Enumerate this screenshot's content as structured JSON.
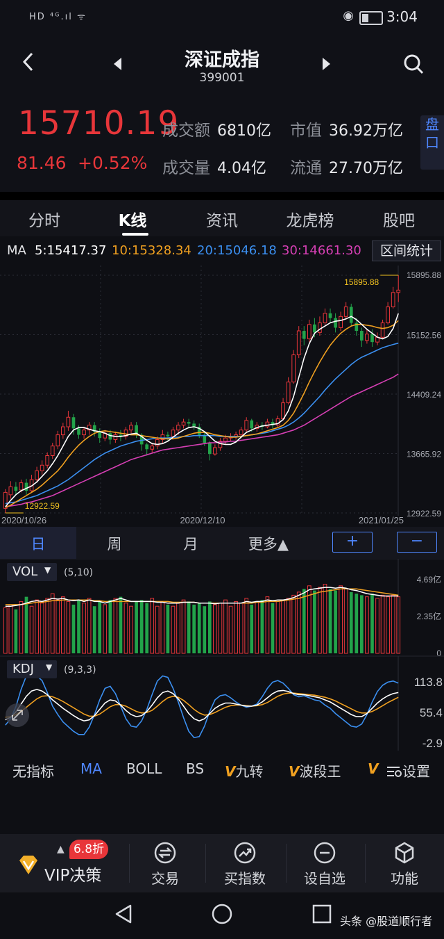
{
  "status_bar": {
    "left_icons": "HD ⁴ᴳ.ıl ᯤ",
    "time": "3:04"
  },
  "header": {
    "title": "深证成指",
    "code": "399001"
  },
  "quote": {
    "price": "15710.19",
    "change": "81.46",
    "change_pct": "+0.52%",
    "turnover_label": "成交额",
    "turnover_value": "6810亿",
    "volume_label": "成交量",
    "volume_value": "4.04亿",
    "mktcap_label": "市值",
    "mktcap_value": "36.92万亿",
    "float_label": "流通",
    "float_value": "27.70万亿",
    "pankou": "盘口",
    "up_color": "#e8363a",
    "down_color": "#22a34a"
  },
  "tabs": [
    "分时",
    "K线",
    "资讯",
    "龙虎榜",
    "股吧"
  ],
  "active_tab": "K线",
  "ma_line": {
    "prefix": "MA",
    "ma5": "5:15417.37",
    "ma10": "10:15328.34",
    "ma20": "20:15046.18",
    "ma30": "30:14661.30",
    "range_button": "区间统计",
    "colors": {
      "ma5": "#ffffff",
      "ma10": "#f0a020",
      "ma20": "#3b8ff0",
      "ma30": "#d63fb4"
    }
  },
  "chart_data": {
    "type": "candlestick",
    "y_ticks": [
      "15895.88",
      "15152.56",
      "14409.24",
      "13665.92",
      "12922.59"
    ],
    "x_ticks": [
      "2020/10/26",
      "2020/12/10",
      "2021/01/25"
    ],
    "max_label": "15895.88",
    "min_label": "12922.59",
    "ylim": [
      12922.59,
      15895.88
    ],
    "candles": [
      [
        12980,
        13180,
        12922.59,
        13220
      ],
      [
        13150,
        13250,
        13100,
        13320
      ],
      [
        13250,
        13200,
        13150,
        13310
      ],
      [
        13210,
        13300,
        13180,
        13340
      ],
      [
        13300,
        13200,
        13150,
        13350
      ],
      [
        13200,
        13340,
        13180,
        13400
      ],
      [
        13340,
        13450,
        13300,
        13500
      ],
      [
        13450,
        13520,
        13400,
        13580
      ],
      [
        13520,
        13640,
        13480,
        13680
      ],
      [
        13640,
        13760,
        13600,
        13800
      ],
      [
        13760,
        13900,
        13720,
        13950
      ],
      [
        13900,
        14000,
        13850,
        14050
      ],
      [
        14000,
        14120,
        13950,
        14200
      ],
      [
        14120,
        13980,
        13900,
        14160
      ],
      [
        13980,
        13900,
        13850,
        14020
      ],
      [
        13900,
        13960,
        13850,
        14000
      ],
      [
        13960,
        14020,
        13900,
        14060
      ],
      [
        14020,
        13940,
        13880,
        14060
      ],
      [
        13940,
        13860,
        13800,
        13980
      ],
      [
        13860,
        13920,
        13820,
        13960
      ],
      [
        13920,
        13840,
        13780,
        13960
      ],
      [
        13840,
        13900,
        13800,
        13940
      ],
      [
        13900,
        13880,
        13820,
        13960
      ],
      [
        13880,
        13960,
        13840,
        14000
      ],
      [
        13960,
        14020,
        13920,
        14060
      ],
      [
        14020,
        13900,
        13860,
        14060
      ],
      [
        13900,
        13780,
        13700,
        13920
      ],
      [
        13780,
        13720,
        13640,
        13800
      ],
      [
        13720,
        13760,
        13680,
        13800
      ],
      [
        13760,
        13840,
        13720,
        13880
      ],
      [
        13840,
        13900,
        13800,
        13960
      ],
      [
        13900,
        13880,
        13820,
        13940
      ],
      [
        13880,
        13960,
        13840,
        14000
      ],
      [
        13960,
        14020,
        13900,
        14060
      ],
      [
        14020,
        14060,
        13980,
        14100
      ],
      [
        14060,
        14040,
        13980,
        14100
      ],
      [
        14040,
        14000,
        13960,
        14080
      ],
      [
        14000,
        13900,
        13860,
        14040
      ],
      [
        13900,
        13800,
        13760,
        13940
      ],
      [
        13800,
        13660,
        13580,
        13820
      ],
      [
        13660,
        13740,
        13640,
        13780
      ],
      [
        13740,
        13820,
        13700,
        13860
      ],
      [
        13820,
        13860,
        13780,
        13900
      ],
      [
        13860,
        13880,
        13820,
        13920
      ],
      [
        13880,
        13900,
        13840,
        13940
      ],
      [
        13900,
        13960,
        13860,
        14000
      ],
      [
        13960,
        14080,
        13940,
        14120
      ],
      [
        14080,
        13980,
        13940,
        14100
      ],
      [
        13980,
        14020,
        13940,
        14060
      ],
      [
        14020,
        14000,
        13960,
        14060
      ],
      [
        14000,
        14060,
        13980,
        14100
      ],
      [
        14060,
        14020,
        13980,
        14100
      ],
      [
        14020,
        14100,
        14000,
        14140
      ],
      [
        14100,
        14300,
        14080,
        14360
      ],
      [
        14300,
        14560,
        14280,
        14620
      ],
      [
        14560,
        14900,
        14540,
        14960
      ],
      [
        14900,
        15200,
        14860,
        15260
      ],
      [
        15200,
        15100,
        15020,
        15260
      ],
      [
        15100,
        15280,
        15060,
        15340
      ],
      [
        15280,
        15180,
        15120,
        15360
      ],
      [
        15180,
        15300,
        15140,
        15380
      ],
      [
        15300,
        15420,
        15260,
        15480
      ],
      [
        15420,
        15360,
        15300,
        15480
      ],
      [
        15360,
        15240,
        15180,
        15420
      ],
      [
        15240,
        15380,
        15200,
        15440
      ],
      [
        15380,
        15500,
        15340,
        15560
      ],
      [
        15500,
        15300,
        15260,
        15540
      ],
      [
        15300,
        15200,
        15140,
        15360
      ],
      [
        15200,
        15080,
        15000,
        15240
      ],
      [
        15080,
        15160,
        15040,
        15220
      ],
      [
        15160,
        15060,
        15000,
        15220
      ],
      [
        15060,
        15120,
        15020,
        15180
      ],
      [
        15120,
        15300,
        15100,
        15340
      ],
      [
        15300,
        15500,
        15280,
        15560
      ],
      [
        15500,
        15680,
        15480,
        15750
      ],
      [
        15680,
        15710.19,
        15560,
        15895.88
      ]
    ],
    "ma5": [
      13000,
      13080,
      13150,
      13200,
      13230,
      13260,
      13310,
      13380,
      13450,
      13540,
      13640,
      13760,
      13880,
      13960,
      13990,
      13990,
      13970,
      13950,
      13940,
      13920,
      13890,
      13880,
      13880,
      13890,
      13910,
      13920,
      13880,
      13830,
      13790,
      13780,
      13790,
      13820,
      13870,
      13920,
      13960,
      13990,
      14000,
      13980,
      13940,
      13880,
      13820,
      13790,
      13780,
      13780,
      13810,
      13870,
      13930,
      13960,
      13990,
      14010,
      14020,
      14030,
      14040,
      14090,
      14200,
      14380,
      14620,
      14860,
      15040,
      15170,
      15220,
      15260,
      15300,
      15320,
      15330,
      15350,
      15380,
      15340,
      15280,
      15220,
      15170,
      15120,
      15100,
      15130,
      15230,
      15417.37
    ],
    "ma10": [
      12990,
      13020,
      13060,
      13100,
      13140,
      13180,
      13220,
      13270,
      13330,
      13390,
      13450,
      13530,
      13620,
      13700,
      13770,
      13830,
      13880,
      13920,
      13940,
      13950,
      13940,
      13930,
      13920,
      13910,
      13900,
      13900,
      13890,
      13880,
      13870,
      13860,
      13850,
      13850,
      13850,
      13860,
      13880,
      13900,
      13920,
      13930,
      13930,
      13920,
      13900,
      13890,
      13880,
      13870,
      13870,
      13880,
      13890,
      13900,
      13910,
      13930,
      13950,
      13970,
      13990,
      14020,
      14080,
      14170,
      14290,
      14420,
      14560,
      14690,
      14810,
      14920,
      15020,
      15100,
      15170,
      15220,
      15260,
      15280,
      15280,
      15270,
      15260,
      15240,
      15230,
      15240,
      15270,
      15328.34
    ],
    "ma20": [
      13040,
      13050,
      13060,
      13080,
      13100,
      13120,
      13140,
      13170,
      13200,
      13230,
      13260,
      13300,
      13340,
      13390,
      13440,
      13490,
      13540,
      13590,
      13630,
      13670,
      13700,
      13730,
      13760,
      13780,
      13800,
      13820,
      13830,
      13840,
      13850,
      13860,
      13860,
      13860,
      13870,
      13870,
      13880,
      13880,
      13890,
      13890,
      13890,
      13890,
      13890,
      13880,
      13880,
      13880,
      13880,
      13880,
      13890,
      13900,
      13910,
      13920,
      13930,
      13950,
      13970,
      13990,
      14020,
      14060,
      14110,
      14170,
      14240,
      14310,
      14380,
      14460,
      14530,
      14600,
      14660,
      14720,
      14780,
      14830,
      14870,
      14900,
      14930,
      14960,
      14990,
      15010,
      15030,
      15046.18
    ],
    "ma30": [
      13000,
      13010,
      13020,
      13030,
      13050,
      13060,
      13080,
      13100,
      13120,
      13140,
      13170,
      13200,
      13230,
      13260,
      13290,
      13320,
      13350,
      13380,
      13410,
      13440,
      13470,
      13500,
      13530,
      13560,
      13590,
      13610,
      13630,
      13650,
      13670,
      13690,
      13710,
      13720,
      13730,
      13740,
      13750,
      13760,
      13770,
      13780,
      13790,
      13800,
      13800,
      13810,
      13810,
      13820,
      13820,
      13830,
      13840,
      13850,
      13860,
      13870,
      13880,
      13890,
      13900,
      13920,
      13940,
      13960,
      13990,
      14020,
      14060,
      14100,
      14140,
      14180,
      14220,
      14260,
      14300,
      14340,
      14380,
      14410,
      14440,
      14470,
      14500,
      14530,
      14560,
      14590,
      14620,
      14661.3
    ]
  },
  "period_bar": {
    "items": [
      "日",
      "周",
      "月",
      "更多▲"
    ],
    "active": "日",
    "plus": "+",
    "minus": "−"
  },
  "vol_panel": {
    "label": "VOL",
    "params": "(5,10)",
    "ticks": [
      "4.69亿",
      "2.35亿",
      "0"
    ],
    "max": 4.69,
    "bars": [
      2.9,
      3.1,
      2.8,
      3.3,
      3.6,
      3.0,
      3.4,
      3.2,
      3.5,
      3.8,
      3.4,
      3.6,
      3.3,
      3.1,
      3.4,
      3.2,
      3.5,
      3.0,
      3.3,
      3.1,
      3.4,
      3.5,
      3.6,
      3.2,
      3.0,
      3.3,
      3.4,
      3.2,
      3.5,
      3.0,
      3.3,
      3.1,
      3.0,
      3.2,
      3.4,
      3.3,
      3.1,
      3.2,
      3.0,
      3.3,
      3.1,
      3.2,
      3.4,
      3.0,
      3.3,
      3.2,
      3.5,
      3.1,
      3.3,
      3.4,
      3.6,
      3.2,
      3.3,
      3.4,
      3.5,
      3.7,
      3.9,
      4.1,
      4.3,
      4.0,
      4.2,
      4.4,
      4.1,
      4.0,
      4.3,
      4.1,
      3.9,
      3.8,
      3.7,
      3.6,
      3.8,
      3.5,
      3.7,
      3.6,
      3.7,
      3.6
    ],
    "vol_ma5": [
      3.0,
      3.0,
      3.05,
      3.1,
      3.2,
      3.3,
      3.35,
      3.3,
      3.4,
      3.5,
      3.45,
      3.5,
      3.4,
      3.35,
      3.4,
      3.3,
      3.4,
      3.3,
      3.3,
      3.2,
      3.3,
      3.4,
      3.5,
      3.4,
      3.3,
      3.3,
      3.3,
      3.3,
      3.3,
      3.25,
      3.25,
      3.2,
      3.2,
      3.2,
      3.25,
      3.25,
      3.25,
      3.2,
      3.2,
      3.2,
      3.15,
      3.2,
      3.2,
      3.2,
      3.2,
      3.2,
      3.3,
      3.25,
      3.3,
      3.3,
      3.4,
      3.35,
      3.4,
      3.4,
      3.45,
      3.55,
      3.7,
      3.85,
      4.05,
      4.1,
      4.15,
      4.2,
      4.2,
      4.15,
      4.2,
      4.15,
      4.05,
      4.0,
      3.9,
      3.8,
      3.75,
      3.7,
      3.65,
      3.65,
      3.65,
      3.65
    ],
    "vol_ma10": [
      3.1,
      3.1,
      3.1,
      3.1,
      3.15,
      3.2,
      3.25,
      3.25,
      3.3,
      3.35,
      3.35,
      3.4,
      3.4,
      3.4,
      3.4,
      3.4,
      3.4,
      3.35,
      3.35,
      3.3,
      3.3,
      3.3,
      3.3,
      3.3,
      3.3,
      3.3,
      3.3,
      3.3,
      3.3,
      3.3,
      3.3,
      3.3,
      3.25,
      3.25,
      3.25,
      3.25,
      3.25,
      3.2,
      3.2,
      3.2,
      3.2,
      3.2,
      3.2,
      3.2,
      3.2,
      3.2,
      3.2,
      3.2,
      3.25,
      3.25,
      3.3,
      3.3,
      3.3,
      3.35,
      3.4,
      3.45,
      3.5,
      3.6,
      3.7,
      3.8,
      3.9,
      3.95,
      4.0,
      4.05,
      4.1,
      4.1,
      4.1,
      4.1,
      4.05,
      4.0,
      3.95,
      3.9,
      3.85,
      3.8,
      3.75,
      3.7
    ]
  },
  "kdj_panel": {
    "label": "KDJ",
    "params": "(9,3,3)",
    "ticks": [
      "113.8",
      "55.4",
      "-2.9"
    ],
    "range": [
      -2.9,
      113.8
    ],
    "k": [
      40,
      45,
      55,
      70,
      85,
      95,
      98,
      95,
      88,
      78,
      70,
      62,
      55,
      48,
      42,
      38,
      40,
      48,
      60,
      72,
      78,
      76,
      68,
      58,
      50,
      46,
      48,
      56,
      68,
      82,
      92,
      95,
      90,
      80,
      66,
      52,
      42,
      38,
      42,
      52,
      62,
      68,
      72,
      72,
      70,
      68,
      66,
      66,
      68,
      74,
      82,
      90,
      95,
      96,
      94,
      90,
      88,
      88,
      86,
      84,
      82,
      78,
      74,
      68,
      62,
      56,
      50,
      46,
      46,
      52,
      62,
      72,
      80,
      86,
      90,
      92
    ],
    "d": [
      45,
      46,
      50,
      56,
      64,
      72,
      80,
      85,
      86,
      84,
      80,
      75,
      69,
      63,
      57,
      51,
      47,
      47,
      51,
      58,
      65,
      69,
      69,
      66,
      61,
      56,
      53,
      54,
      58,
      66,
      75,
      82,
      85,
      83,
      77,
      69,
      60,
      53,
      49,
      50,
      54,
      59,
      64,
      67,
      68,
      68,
      67,
      66,
      67,
      69,
      73,
      79,
      85,
      89,
      91,
      91,
      90,
      89,
      88,
      87,
      85,
      83,
      80,
      76,
      71,
      66,
      61,
      56,
      53,
      53,
      56,
      61,
      67,
      73,
      78,
      83
    ],
    "j": [
      30,
      42,
      65,
      98,
      125,
      140,
      134,
      115,
      92,
      66,
      50,
      36,
      27,
      18,
      12,
      12,
      26,
      50,
      78,
      100,
      104,
      90,
      66,
      42,
      28,
      26,
      38,
      60,
      88,
      114,
      126,
      121,
      100,
      74,
      44,
      18,
      6,
      8,
      28,
      56,
      78,
      86,
      88,
      82,
      74,
      68,
      64,
      66,
      70,
      84,
      100,
      112,
      115,
      110,
      100,
      88,
      84,
      86,
      82,
      78,
      76,
      68,
      62,
      52,
      44,
      36,
      28,
      26,
      32,
      50,
      74,
      94,
      106,
      112,
      114,
      110
    ]
  },
  "indicator_bar": {
    "items": [
      "无指标",
      "MA",
      "BOLL",
      "BS",
      "九转",
      "波段王"
    ],
    "active": "MA",
    "vmark": "V",
    "settings": "设置"
  },
  "bottom_bar": {
    "vip_label": "VIP决策",
    "discount": "6.8折",
    "items": [
      {
        "label": "交易",
        "icon": "trade-icon"
      },
      {
        "label": "买指数",
        "icon": "buy-index-icon"
      },
      {
        "label": "设自选",
        "icon": "add-watchlist-icon"
      },
      {
        "label": "功能",
        "icon": "function-icon"
      }
    ]
  },
  "watermark": "头条 @股道顺行者"
}
